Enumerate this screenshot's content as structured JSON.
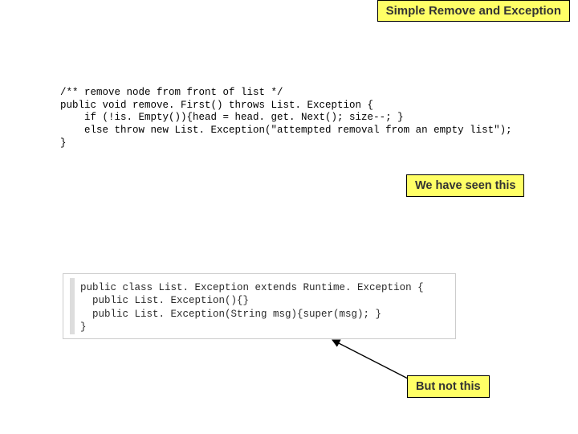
{
  "title": "Simple Remove and Exception",
  "code1": {
    "l1": "/** remove node from front of list */",
    "l2": "public void remove. First() throws List. Exception {",
    "l3": "    if (!is. Empty()){head = head. get. Next(); size--; }",
    "l4": "    else throw new List. Exception(\"attempted removal from an empty list\");",
    "l5": "}"
  },
  "callout1": "We have seen this",
  "code2": {
    "l1": "public class List. Exception extends Runtime. Exception {",
    "l2": "  public List. Exception(){}",
    "l3": "  public List. Exception(String msg){super(msg); }",
    "l4": "}"
  },
  "callout2": "But not this"
}
